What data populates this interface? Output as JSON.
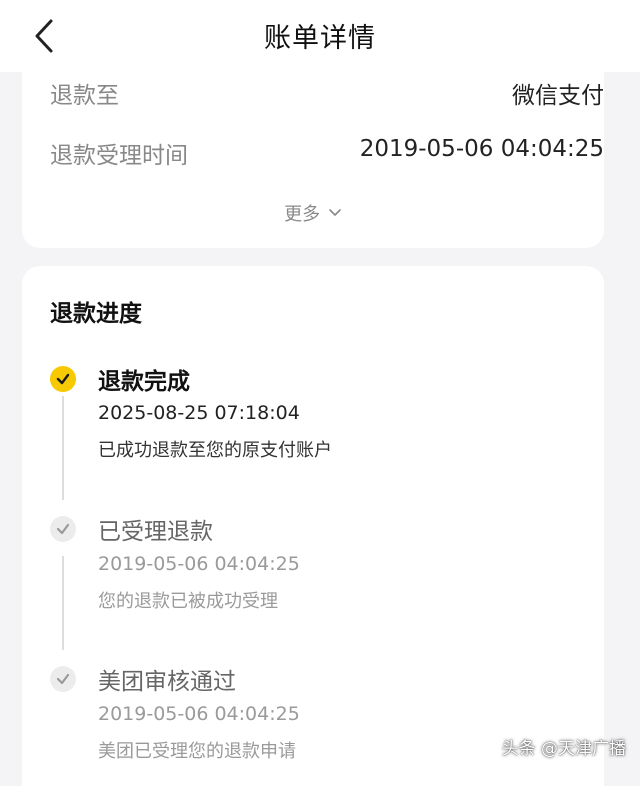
{
  "header": {
    "title": "账单详情"
  },
  "summary": {
    "refund_to_label": "退款至",
    "refund_to_value": "微信支付",
    "accept_time_label": "退款受理时间",
    "accept_time_value": "2019-05-06 04:04:25",
    "more_label": "更多"
  },
  "progress": {
    "title": "退款进度",
    "steps": [
      {
        "title": "退款完成",
        "time": "2025-08-25 07:18:04",
        "desc": "已成功退款至您的原支付账户"
      },
      {
        "title": "已受理退款",
        "time": "2019-05-06 04:04:25",
        "desc": "您的退款已被成功受理"
      },
      {
        "title": "美团审核通过",
        "time": "2019-05-06 04:04:25",
        "desc": "美团已受理您的退款申请"
      }
    ]
  },
  "watermark": "头条 @天津广播",
  "colors": {
    "accent": "#f7c900",
    "background": "#f4f4f6",
    "muted_text": "#9a9a9a"
  },
  "icons": {
    "back": "chevron-left-icon",
    "more": "chevron-down-icon",
    "step": "check-icon"
  }
}
